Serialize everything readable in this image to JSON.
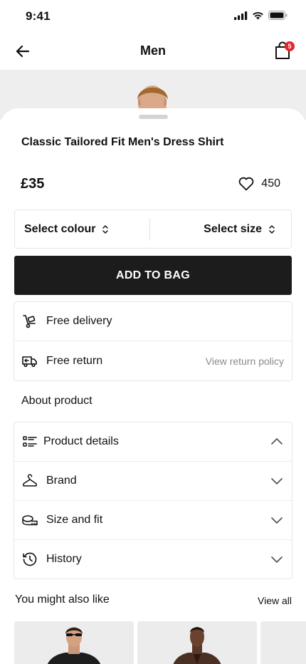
{
  "status_bar": {
    "time": "9:41"
  },
  "nav": {
    "title": "Men",
    "bag_count": "5"
  },
  "product": {
    "title": "Classic Tailored Fit Men's Dress Shirt",
    "price": "£35",
    "favourites": "450"
  },
  "selectors": {
    "colour_label": "Select colour",
    "size_label": "Select size"
  },
  "add_to_bag_label": "ADD TO BAG",
  "services": {
    "delivery_label": "Free delivery",
    "return_label": "Free return",
    "return_policy_link": "View return policy"
  },
  "about": {
    "heading": "About product",
    "sections": [
      {
        "label": "Product details",
        "icon": "list-icon",
        "expanded": true
      },
      {
        "label": "Brand",
        "icon": "hanger-icon",
        "expanded": false
      },
      {
        "label": "Size and fit",
        "icon": "tape-measure-icon",
        "expanded": false
      },
      {
        "label": "History",
        "icon": "history-icon",
        "expanded": false
      }
    ]
  },
  "recommendations": {
    "heading": "You might also like",
    "view_all_label": "View all"
  },
  "colors": {
    "primary_button": "#1c1c1c",
    "badge": "#e5252a",
    "muted_text": "#8a8a8a",
    "image_background": "#eeeeee"
  }
}
